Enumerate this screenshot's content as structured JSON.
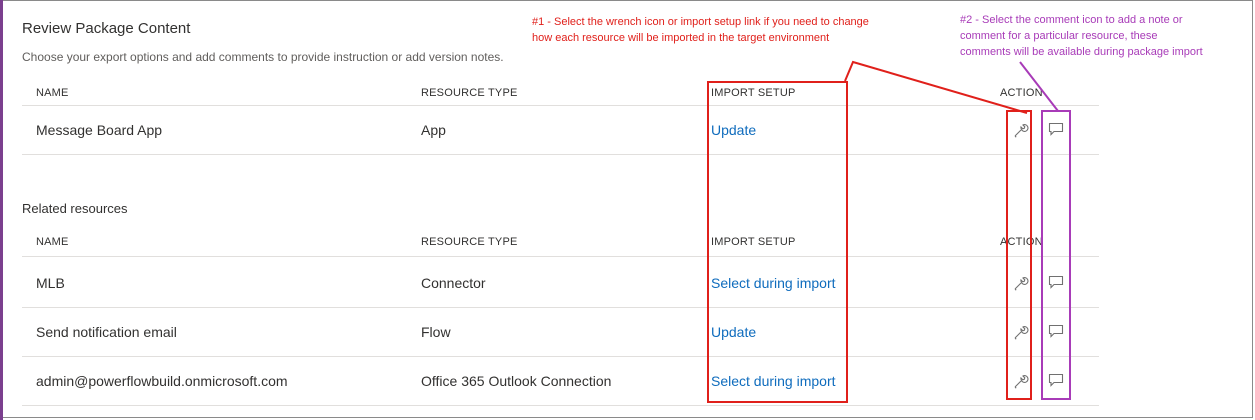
{
  "header": {
    "title": "Review Package Content",
    "subtitle": "Choose your export options and add comments to provide instruction or add version notes."
  },
  "columns": {
    "name": "NAME",
    "resource_type": "RESOURCE TYPE",
    "import_setup": "IMPORT SETUP",
    "action": "ACTION"
  },
  "main_row": {
    "name": "Message Board App",
    "type": "App",
    "import_setup": "Update"
  },
  "related": {
    "label": "Related resources",
    "rows": [
      {
        "name": "MLB",
        "type": "Connector",
        "import_setup": "Select during import"
      },
      {
        "name": "Send notification email",
        "type": "Flow",
        "import_setup": "Update"
      },
      {
        "name": "admin@powerflowbuild.onmicrosoft.com",
        "type": "Office 365 Outlook Connection",
        "import_setup": "Select during import"
      }
    ]
  },
  "annotations": {
    "callout1_line1": "#1 - Select the wrench icon or import setup link if you need to change",
    "callout1_line2": "how each resource will be imported in the target environment",
    "callout2_line1": "#2 - Select the comment icon to add a note or",
    "callout2_line2": "comment for a particular resource, these",
    "callout2_line3": "comments will be available during package import"
  },
  "icons": {
    "edit_setup": "wrench-icon",
    "comment": "comment-icon"
  },
  "colors": {
    "annotation_red": "#e0201b",
    "annotation_purple": "#a83bb8",
    "link_blue": "#0f6cbd"
  }
}
